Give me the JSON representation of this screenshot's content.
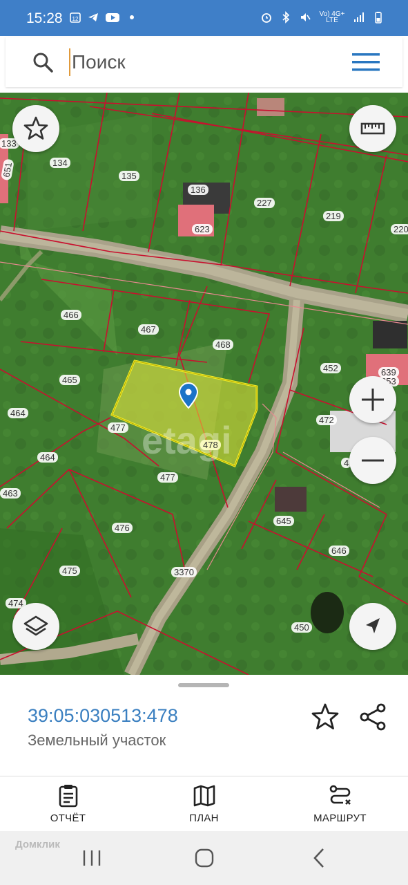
{
  "status_bar": {
    "time": "15:28",
    "network": "Vo) 4G+ LTE",
    "notif_badge": "12"
  },
  "search": {
    "placeholder": "Поиск"
  },
  "map": {
    "watermark": "etagi",
    "selected_plot_label": "478",
    "plot_labels": [
      {
        "id": "133"
      },
      {
        "id": "651"
      },
      {
        "id": "134"
      },
      {
        "id": "135"
      },
      {
        "id": "136"
      },
      {
        "id": "623"
      },
      {
        "id": "227"
      },
      {
        "id": "219"
      },
      {
        "id": "220"
      },
      {
        "id": "466"
      },
      {
        "id": "467"
      },
      {
        "id": "468"
      },
      {
        "id": "465"
      },
      {
        "id": "452"
      },
      {
        "id": "639"
      },
      {
        "id": "653"
      },
      {
        "id": "464"
      },
      {
        "id": "477"
      },
      {
        "id": "478"
      },
      {
        "id": "472"
      },
      {
        "id": "464"
      },
      {
        "id": "477"
      },
      {
        "id": "463"
      },
      {
        "id": "645"
      },
      {
        "id": "476"
      },
      {
        "id": "646"
      },
      {
        "id": "3370"
      },
      {
        "id": "475"
      },
      {
        "id": "474"
      },
      {
        "id": "450"
      },
      {
        "id": "4"
      }
    ]
  },
  "sheet": {
    "cadastral_number": "39:05:030513:478",
    "object_type": "Земельный участок"
  },
  "actions": [
    {
      "label": "ОТЧЁТ",
      "icon": "clipboard-icon"
    },
    {
      "label": "ПЛАН",
      "icon": "map-icon"
    },
    {
      "label": "МАРШРУТ",
      "icon": "route-icon"
    }
  ],
  "watermark_bottom": "Домклик",
  "colors": {
    "status_bar": "#3f7fc8",
    "accent_blue": "#3a7fc0",
    "selection_yellow": "#e8e83a",
    "boundary_red": "#c8102e",
    "pin_blue": "#1a73c8"
  }
}
